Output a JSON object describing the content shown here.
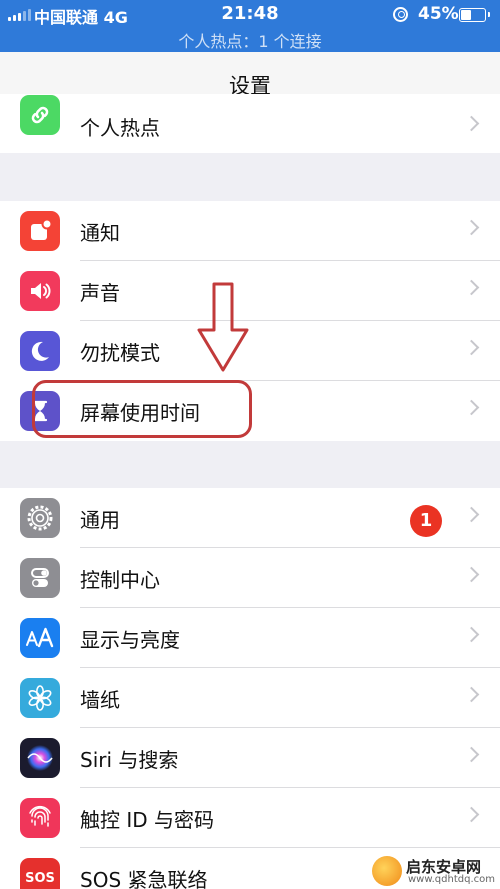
{
  "status_bar": {
    "carrier": "中国联通 4G",
    "time": "21:48",
    "battery_percent": "45%",
    "battery_level": 0.45,
    "hotspot_banner": "个人热点：1 个连接",
    "color": "#2f7ad9"
  },
  "nav": {
    "title": "设置"
  },
  "groups": [
    {
      "items": [
        {
          "label": "个人热点",
          "icon": "link-icon",
          "icon_color": "#4cd964"
        }
      ]
    },
    {
      "items": [
        {
          "label": "通知",
          "icon": "notification-icon",
          "icon_color": "#f44336"
        },
        {
          "label": "声音",
          "icon": "speaker-icon",
          "icon_color": "#f23a5c"
        },
        {
          "label": "勿扰模式",
          "icon": "moon-icon",
          "icon_color": "#5856d6"
        },
        {
          "label": "屏幕使用时间",
          "icon": "hourglass-icon",
          "icon_color": "#5e52c9"
        }
      ]
    },
    {
      "items": [
        {
          "label": "通用",
          "icon": "gear-icon",
          "icon_color": "#8e8e93",
          "badge": "1"
        },
        {
          "label": "控制中心",
          "icon": "toggles-icon",
          "icon_color": "#8e8e93"
        },
        {
          "label": "显示与亮度",
          "icon": "text-size-icon",
          "icon_color": "#1a7ff0"
        },
        {
          "label": "墙纸",
          "icon": "flower-icon",
          "icon_color": "#35aadc"
        },
        {
          "label": "Siri 与搜索",
          "icon": "siri-icon",
          "icon_color": "#1b1b2e"
        },
        {
          "label": "触控 ID 与密码",
          "icon": "fingerprint-icon",
          "icon_color": "#f0365a"
        },
        {
          "label": "SOS 紧急联络",
          "icon": "sos-icon",
          "icon_color": "#e5302d",
          "icon_text": "SOS"
        }
      ]
    }
  ],
  "watermark": {
    "title": "启东安卓网",
    "url": "www.qdhtdq.com"
  }
}
